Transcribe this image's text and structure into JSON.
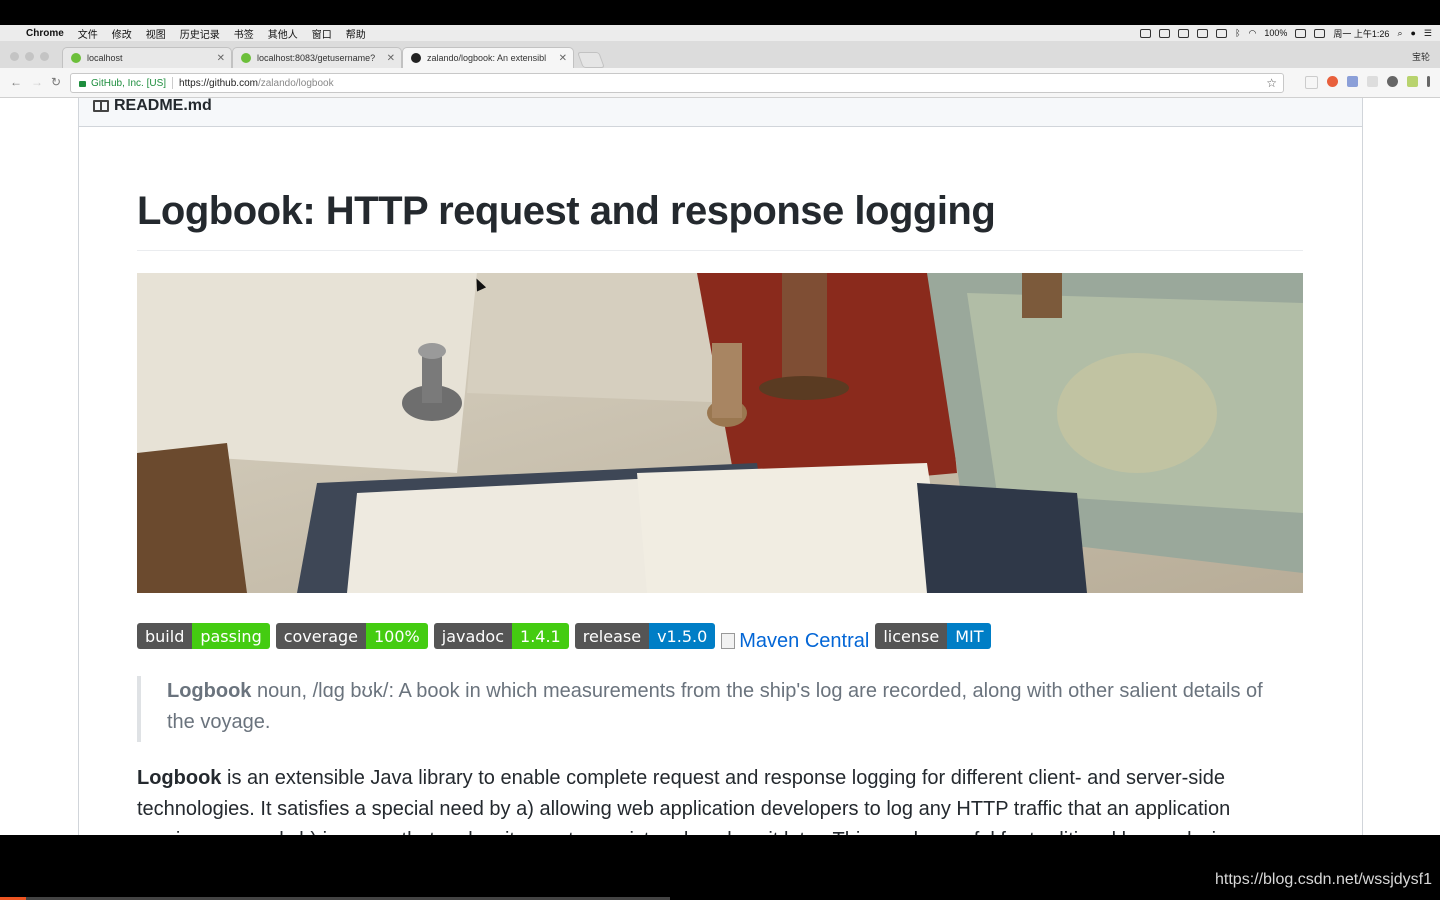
{
  "menubar": {
    "app": "Chrome",
    "items": [
      "文件",
      "修改",
      "视图",
      "历史记录",
      "书签",
      "其他人",
      "窗口",
      "帮助"
    ],
    "battery": "100%",
    "clock": "周一 上午1:26"
  },
  "browser": {
    "tabs": [
      {
        "title": "localhost"
      },
      {
        "title": "localhost:8083/getusername?"
      },
      {
        "title": "zalando/logbook: An extensibl"
      }
    ],
    "profile": "宝轮",
    "cert_label": "GitHub, Inc. [US]",
    "url_host": "https://github.com",
    "url_path": "/zalando/logbook"
  },
  "readme": {
    "file_title": "README.md",
    "heading": "Logbook: HTTP request and response logging",
    "badges": [
      {
        "label": "build",
        "value": "passing",
        "color": "#4c1"
      },
      {
        "label": "coverage",
        "value": "100%",
        "color": "#4c1"
      },
      {
        "label": "javadoc",
        "value": "1.4.1",
        "color": "#4c1"
      },
      {
        "label": "release",
        "value": "v1.5.0",
        "color": "#007ec6"
      },
      {
        "label": "license",
        "value": "MIT",
        "color": "#007ec6"
      }
    ],
    "maven_alt": "Maven Central",
    "quote_term": "Logbook",
    "quote_text": " noun, /lɑɡ bʊk/: A book in which measurements from the ship's log are recorded, along with other salient details of the voyage.",
    "para_term": "Logbook",
    "para_text": " is an extensible Java library to enable complete request and response logging for different client- and server-side technologies. It satisfies a special need by a) allowing web application developers to log any HTTP traffic that an application receives or sends b) in a way that makes it easy to persist and analyze it later. This can be useful for traditional log analysis,"
  },
  "watermark": "https://blog.csdn.net/wssjdysf1"
}
